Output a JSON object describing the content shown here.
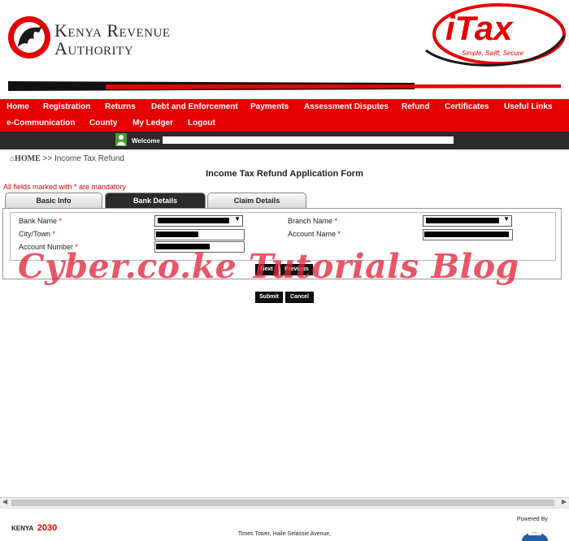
{
  "header": {
    "org_line1": "Kenya Revenue",
    "org_line2": "Authority",
    "itax_title": "iTax",
    "itax_tagline": "Simple, Swift, Secure"
  },
  "nav": {
    "row1": [
      "Home",
      "Registration",
      "Returns",
      "Debt and Enforcement",
      "Payments",
      "Assessment Disputes",
      "Refund",
      "Certificates",
      "Useful Links"
    ],
    "row2": [
      "e-Communication",
      "County",
      "My Ledger",
      "Logout"
    ]
  },
  "welcome": {
    "label": "Welcome"
  },
  "breadcrumb": {
    "home": "HOME",
    "separator": ">>",
    "current": "Income Tax Refund"
  },
  "form": {
    "title": "Income Tax Refund Application Form",
    "mandatory_note": "All fields marked with * are mandatory",
    "tabs": [
      "Basic Info",
      "Bank Details",
      "Claim Details"
    ],
    "active_tab": "Bank Details",
    "fields": {
      "bank_name": "Bank Name",
      "branch_name": "Branch Name",
      "city_town": "City/Town",
      "account_name": "Account Name",
      "account_number": "Account Number",
      "required_mark": "*"
    },
    "buttons": {
      "next": "Next",
      "previous": "Previous",
      "submit": "Submit",
      "cancel": "Cancel"
    }
  },
  "watermark": "Cyber.co.ke Tutorials Blog",
  "footer": {
    "powered_by": "Powered By",
    "address": "Times Tower, Haile Selassie Avenue,",
    "kenya_logo_text": "KENYA",
    "kenya_logo_year": "2030"
  },
  "colors": {
    "brand_red": "#e60000",
    "dark_bar": "#2b2b2b",
    "mandatory_red": "#cc0000"
  }
}
